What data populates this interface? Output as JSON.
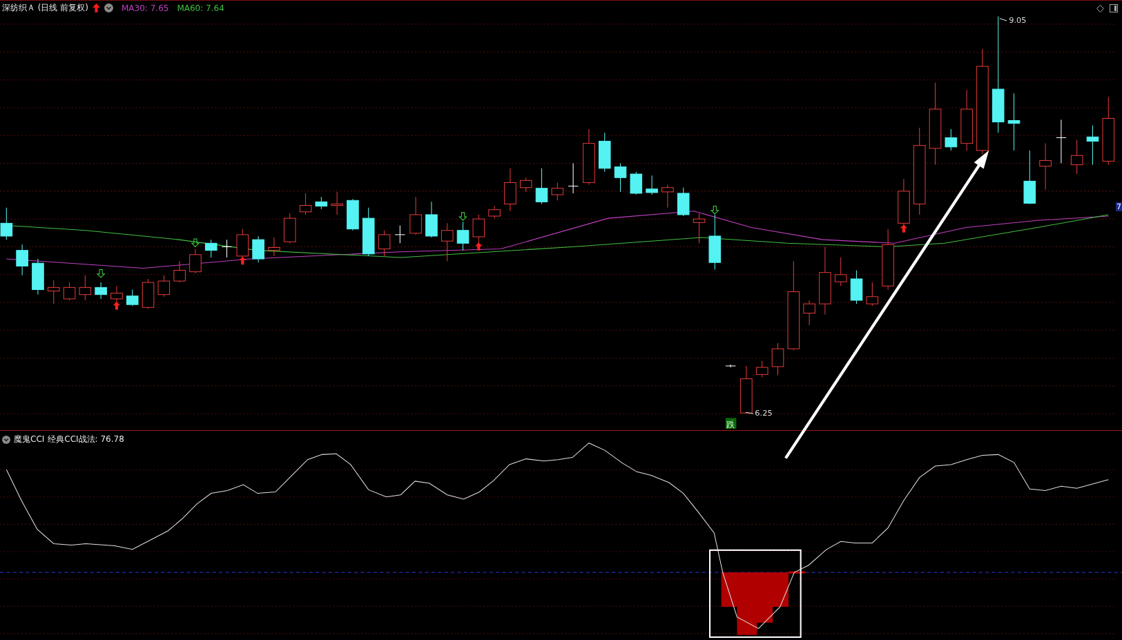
{
  "header": {
    "symbol": "深纺织Ａ (日线 前复权)",
    "ma": [
      {
        "label": "MA30: 7.65",
        "color": "#c040c0"
      },
      {
        "label": "MA60: 7.64",
        "color": "#40c040"
      }
    ]
  },
  "price_chart": {
    "high_label": "9.05",
    "low_label": "6.25",
    "signal_tag": "跌",
    "edge_label": "7"
  },
  "indicator": {
    "name": "魔鬼CCI",
    "readout": "经典CCI战法: 76.78"
  }
}
